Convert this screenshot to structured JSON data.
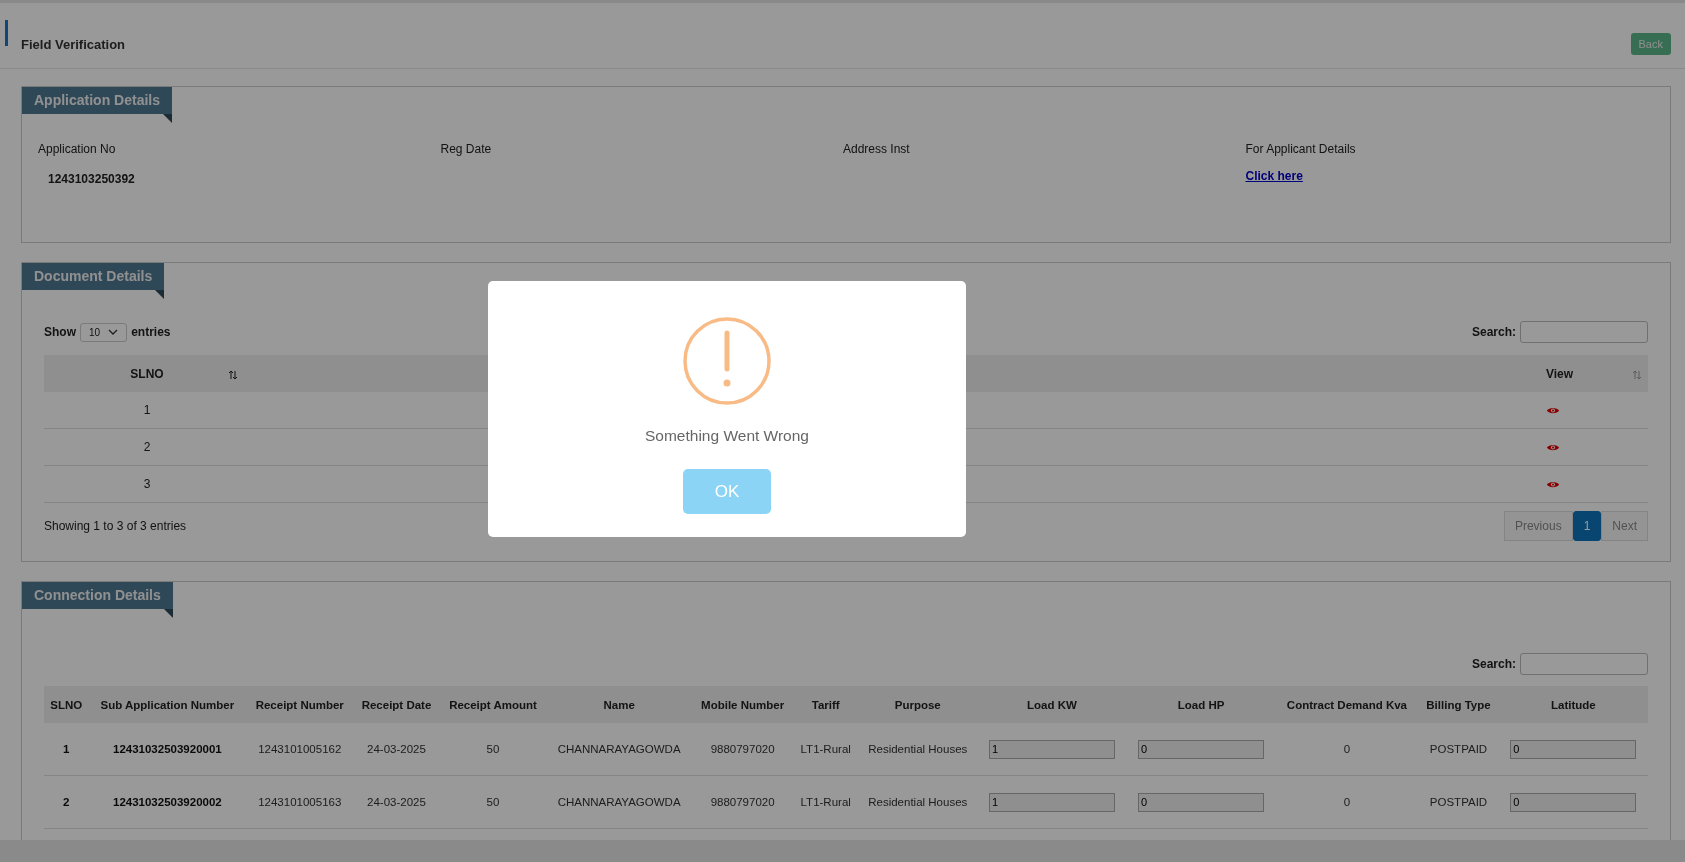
{
  "header": {
    "title": "Field Verification",
    "back_button": "Back"
  },
  "application_details": {
    "title": "Application Details",
    "fields": [
      {
        "label": "Application No",
        "value": "1243103250392"
      },
      {
        "label": "Reg Date"
      },
      {
        "label": "Address Inst"
      }
    ],
    "applicant_details": {
      "label": "For Applicant Details",
      "link": "Click here"
    }
  },
  "document_details": {
    "title": "Document Details",
    "show_label": "Show",
    "page_length": "10",
    "entries_label": "entries",
    "search_label": "Search:",
    "columns": [
      "SLNO",
      "View"
    ],
    "rows": [
      {
        "slno": "1"
      },
      {
        "slno": "2"
      },
      {
        "slno": "3"
      }
    ],
    "info": "Showing 1 to 3 of 3 entries",
    "pagination": {
      "previous": "Previous",
      "pages": [
        {
          "label": "1",
          "selected": true
        }
      ],
      "next": "Next"
    }
  },
  "connection_details": {
    "title": "Connection Details",
    "search_label": "Search:",
    "columns": [
      "SLNO",
      "Sub Application Number",
      "Receipt Number",
      "Receipt Date",
      "Receipt Amount",
      "Name",
      "Mobile Number",
      "Tariff",
      "Purpose",
      "Load KW",
      "Load HP",
      "Contract Demand Kva",
      "Billing Type",
      "Latitude"
    ],
    "rows": [
      {
        "cells": [
          {
            "kind": "bold",
            "value": "1"
          },
          {
            "kind": "bold",
            "value": "12431032503920001"
          },
          {
            "kind": "text",
            "value": "1243101005162"
          },
          {
            "kind": "text",
            "value": "24-03-2025"
          },
          {
            "kind": "text",
            "value": "50"
          },
          {
            "kind": "text",
            "value": "CHANNARAYAGOWDA"
          },
          {
            "kind": "text",
            "value": "9880797020"
          },
          {
            "kind": "text",
            "value": "LT1-Rural"
          },
          {
            "kind": "text",
            "value": "Residential Houses"
          },
          {
            "kind": "input",
            "value": "1"
          },
          {
            "kind": "input",
            "value": "0"
          },
          {
            "kind": "text",
            "value": "0"
          },
          {
            "kind": "text",
            "value": "POSTPAID"
          },
          {
            "kind": "input",
            "value": "0"
          }
        ]
      },
      {
        "cells": [
          {
            "kind": "bold",
            "value": "2"
          },
          {
            "kind": "bold",
            "value": "12431032503920002"
          },
          {
            "kind": "text",
            "value": "1243101005163"
          },
          {
            "kind": "text",
            "value": "24-03-2025"
          },
          {
            "kind": "text",
            "value": "50"
          },
          {
            "kind": "text",
            "value": "CHANNARAYAGOWDA"
          },
          {
            "kind": "text",
            "value": "9880797020"
          },
          {
            "kind": "text",
            "value": "LT1-Rural"
          },
          {
            "kind": "text",
            "value": "Residential Houses"
          },
          {
            "kind": "input",
            "value": "1"
          },
          {
            "kind": "input",
            "value": "0"
          },
          {
            "kind": "text",
            "value": "0"
          },
          {
            "kind": "text",
            "value": "POSTPAID"
          },
          {
            "kind": "input",
            "value": "0"
          }
        ]
      }
    ]
  },
  "modal": {
    "message": "Something Went Wrong",
    "button": "OK"
  }
}
